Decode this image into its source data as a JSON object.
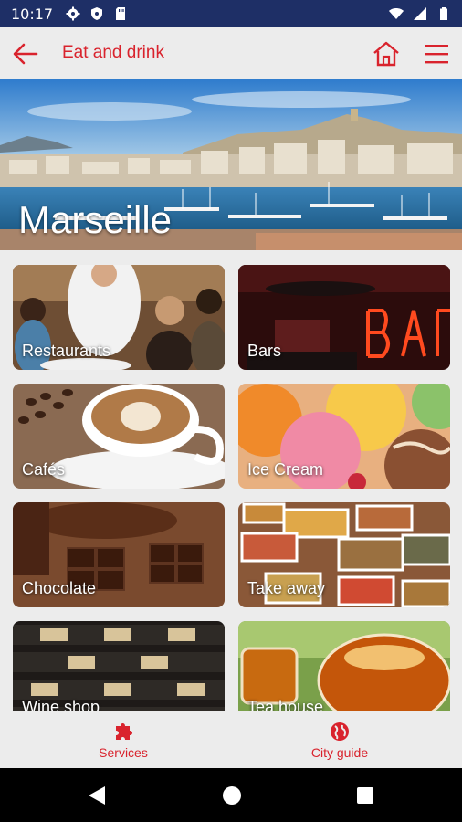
{
  "status_bar": {
    "time": "10:17"
  },
  "app_bar": {
    "title": "Eat and drink"
  },
  "hero": {
    "city": "Marseille"
  },
  "categories": [
    {
      "label": "Restaurants",
      "color": "#7a5a3c"
    },
    {
      "label": "Bars",
      "color": "#3a1010"
    },
    {
      "label": "Cafés",
      "color": "#7d5638"
    },
    {
      "label": "Ice Cream",
      "color": "#e89a7a"
    },
    {
      "label": "Chocolate",
      "color": "#5a3420"
    },
    {
      "label": "Take away",
      "color": "#8a5a3a"
    },
    {
      "label": "Wine shop",
      "color": "#2a2420"
    },
    {
      "label": "Tea house",
      "color": "#9c5a14"
    }
  ],
  "bottom_nav": {
    "services": "Services",
    "city_guide": "City guide"
  },
  "theme": {
    "accent": "#d9232d",
    "status_bar_bg": "#1e2f66"
  }
}
